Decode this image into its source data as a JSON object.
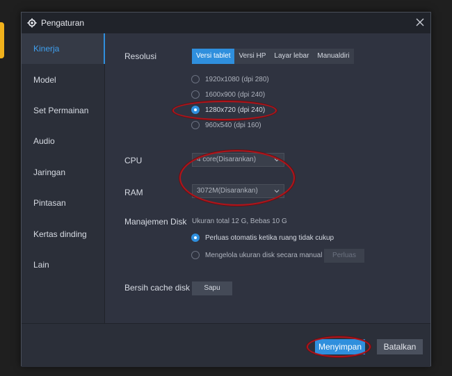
{
  "window": {
    "title": "Pengaturan"
  },
  "sidebar": {
    "items": [
      {
        "label": "Kinerja",
        "active": true
      },
      {
        "label": "Model"
      },
      {
        "label": "Set Permainan"
      },
      {
        "label": "Audio"
      },
      {
        "label": "Jaringan"
      },
      {
        "label": "Pintasan"
      },
      {
        "label": "Kertas dinding"
      },
      {
        "label": "Lain"
      }
    ]
  },
  "resolution": {
    "label": "Resolusi",
    "tabs": [
      "Versi tablet",
      "Versi HP",
      "Layar lebar",
      "Manualdiri"
    ],
    "selected_tab": "Versi tablet",
    "options": [
      "1920x1080  (dpi 280)",
      "1600x900  (dpi 240)",
      "1280x720  (dpi 240)",
      "960x540  (dpi 160)"
    ],
    "selected_option": "1280x720  (dpi 240)"
  },
  "cpu": {
    "label": "CPU",
    "value": "4 core(Disarankan)"
  },
  "ram": {
    "label": "RAM",
    "value": "3072M(Disarankan)"
  },
  "disk": {
    "label": "Manajemen Disk",
    "info": "Ukuran total 12 G,  Bebas 10 G",
    "options": [
      "Perluas otomatis ketika ruang tidak cukup",
      "Mengelola ukuran disk secara manual"
    ],
    "selected_option": "Perluas otomatis ketika ruang tidak cukup",
    "expand_button": "Perluas"
  },
  "cache": {
    "label": "Bersih cache disk",
    "button": "Sapu"
  },
  "footer": {
    "save": "Menyimpan",
    "cancel": "Batalkan"
  },
  "colors": {
    "accent": "#2f8fdd",
    "highlight_ring": "#b0141a"
  }
}
